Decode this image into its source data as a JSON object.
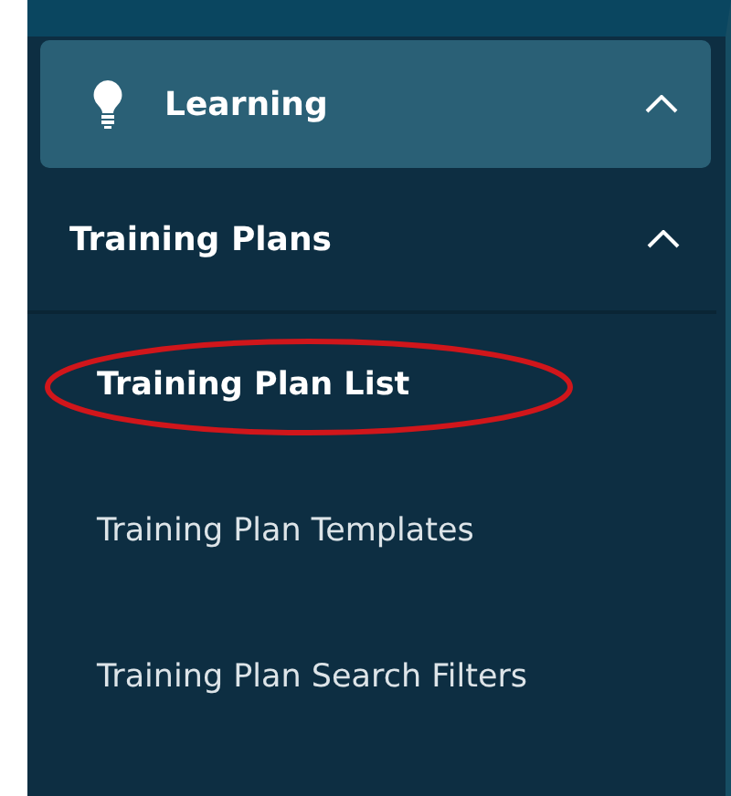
{
  "menu": {
    "label": "Learning",
    "expanded": true,
    "submenu": {
      "label": "Training Plans",
      "expanded": true,
      "items": [
        {
          "label": "Training Plan List",
          "selected": true
        },
        {
          "label": "Training Plan Templates",
          "selected": false
        },
        {
          "label": "Training Plan Search Filters",
          "selected": false
        }
      ]
    }
  }
}
